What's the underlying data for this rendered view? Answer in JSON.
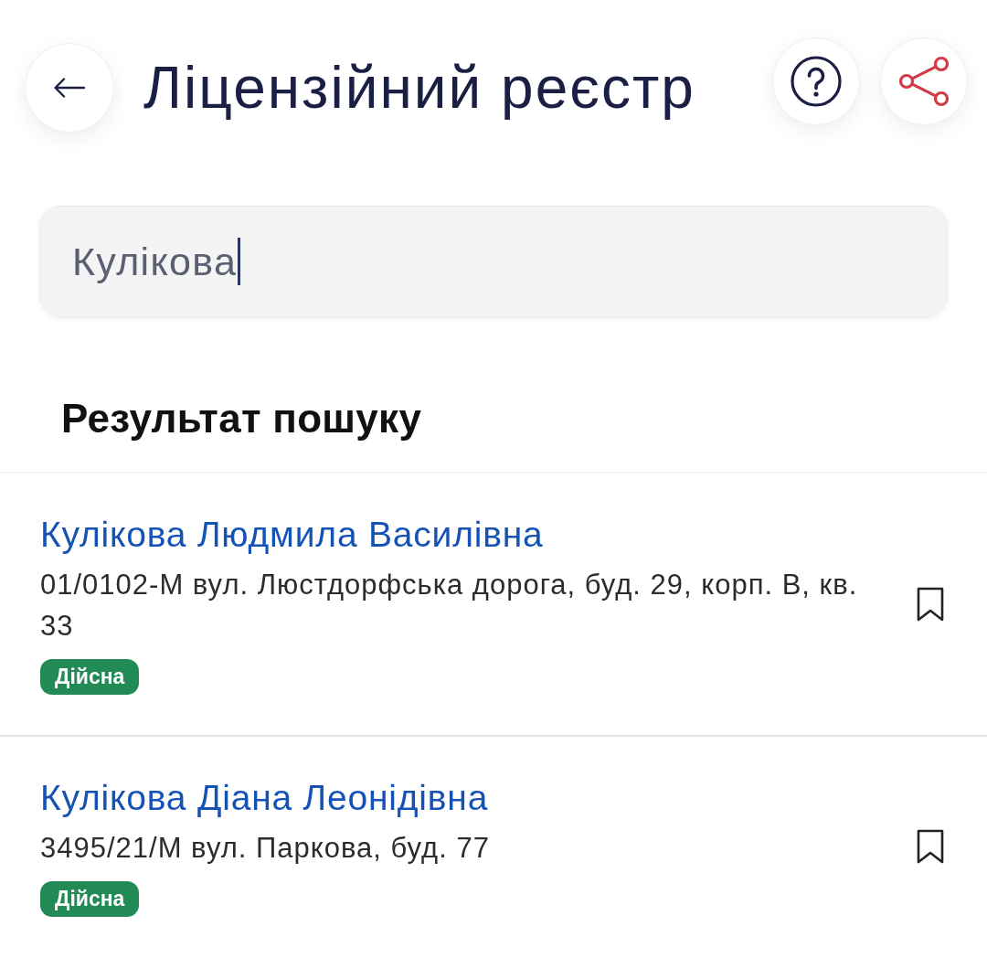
{
  "header": {
    "title": "Ліцензійний реєстр"
  },
  "search": {
    "value": "Кулікова",
    "focused": true
  },
  "results": {
    "title": "Результат пошуку",
    "items": [
      {
        "name": "Кулікова Людмила Василівна",
        "details": "01/0102-М вул. Люстдорфська дорога, буд. 29, корп. В, кв. 33",
        "status": "Дійсна",
        "bookmarked": false
      },
      {
        "name": "Кулікова Діана Леонідівна",
        "details": "3495/21/М вул. Паркова, буд. 77",
        "status": "Дійсна",
        "bookmarked": false
      }
    ]
  }
}
